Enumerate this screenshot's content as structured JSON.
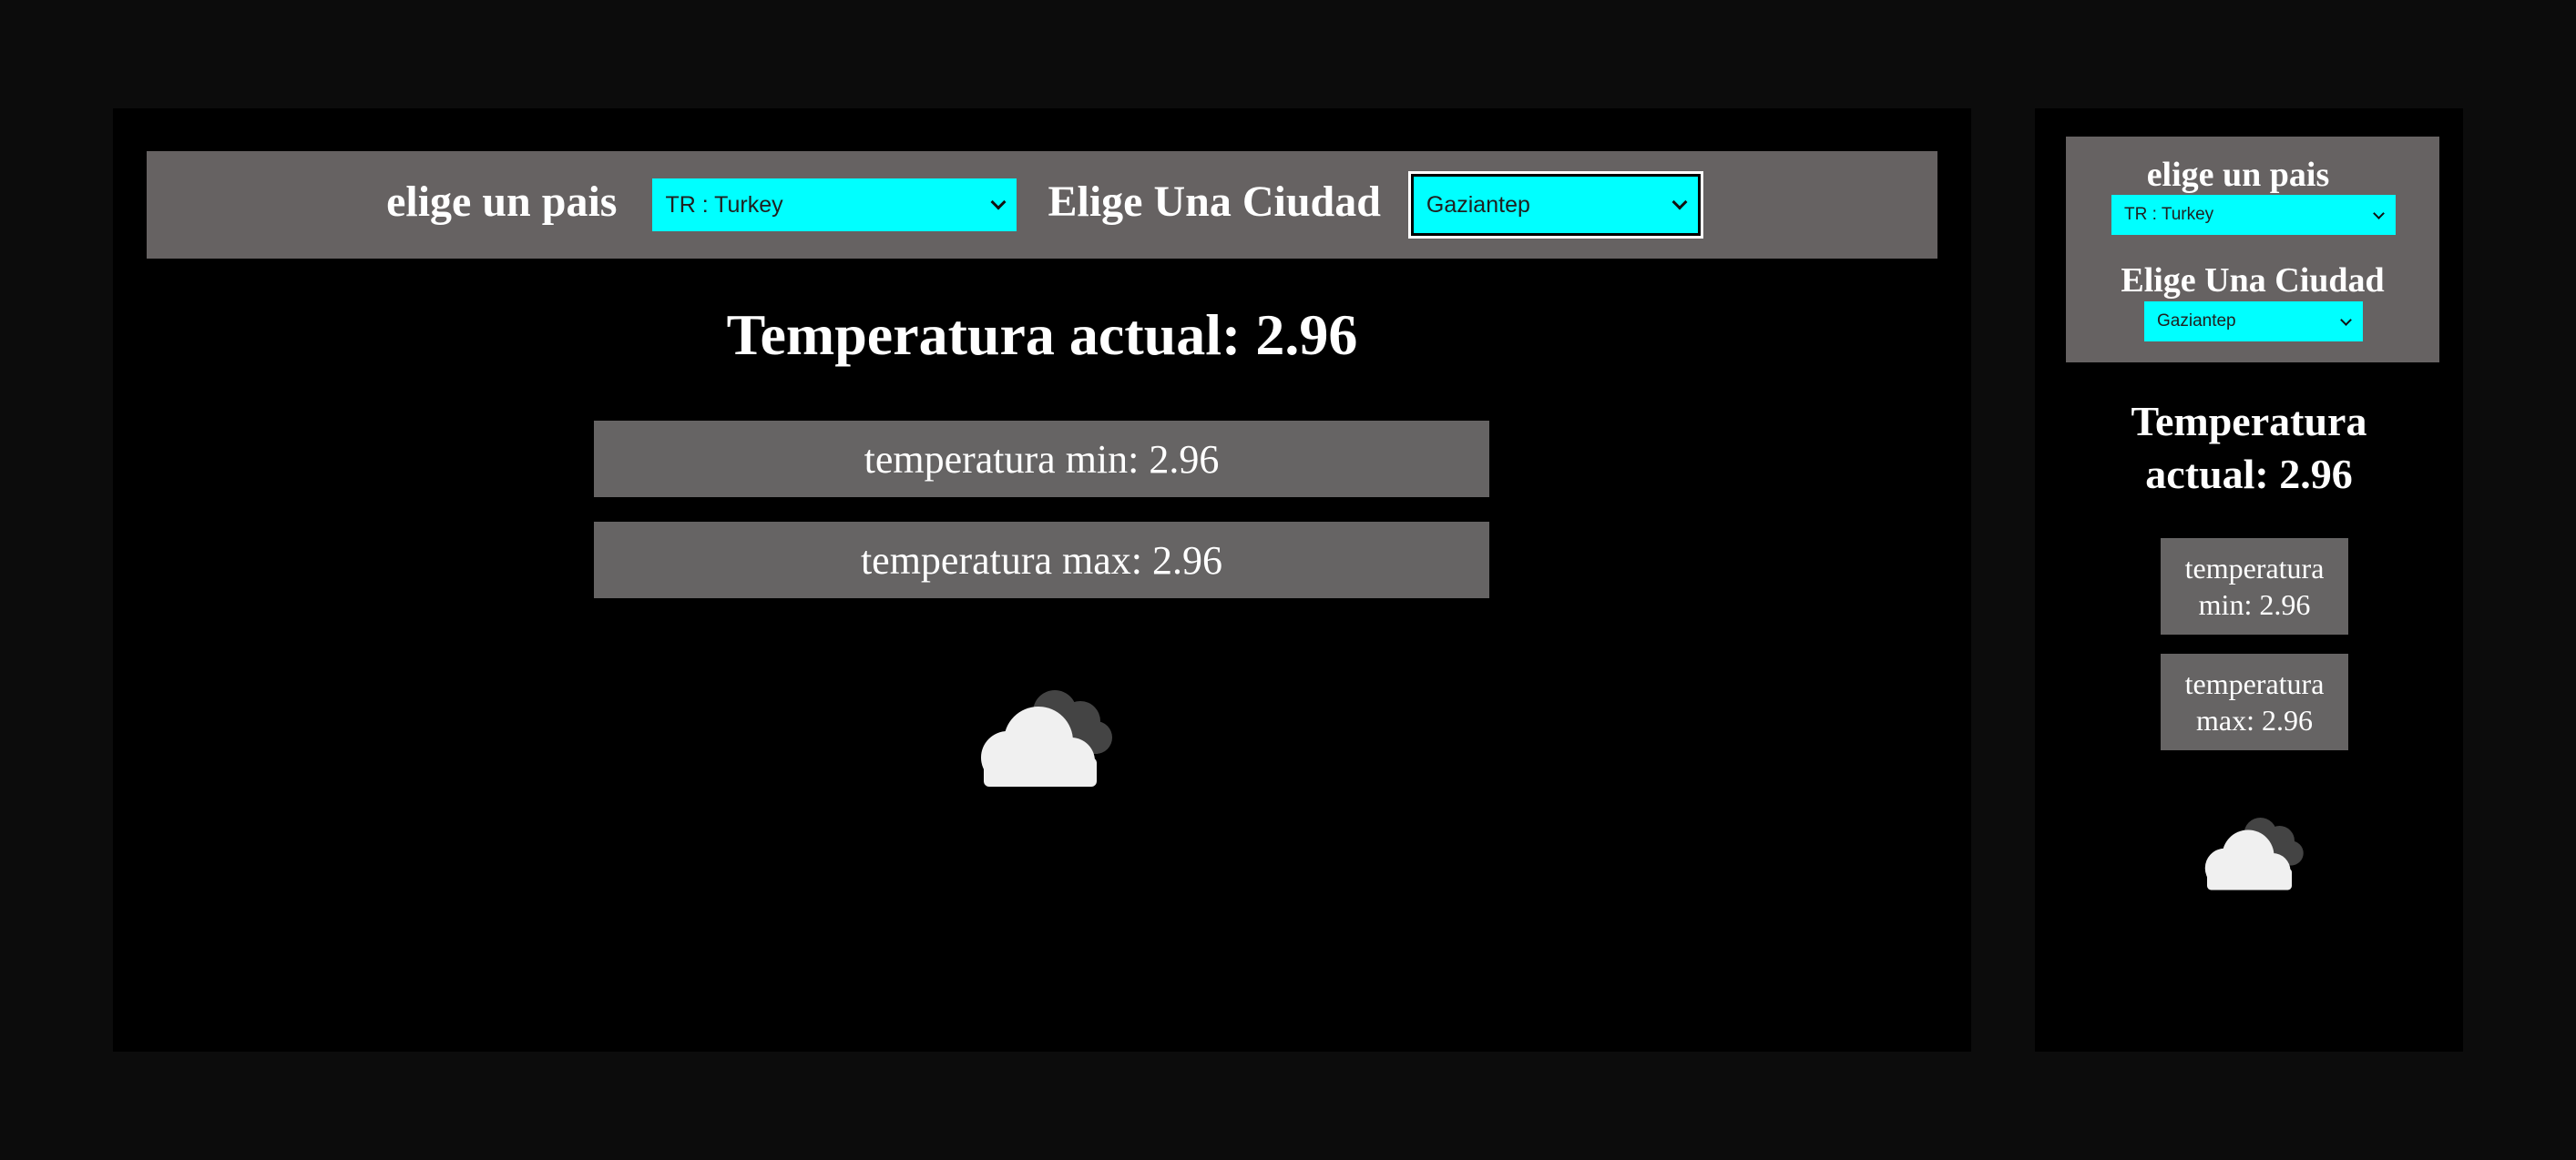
{
  "desktop": {
    "country_label": "elige un pais",
    "country_selected": "TR : Turkey",
    "city_label": "Elige Una Ciudad",
    "city_selected": "Gaziantep",
    "temp_actual": "Temperatura actual: 2.96",
    "temp_min": "temperatura min: 2.96",
    "temp_max": "temperatura max: 2.96",
    "weather_icon": "cloudy-icon"
  },
  "mobile": {
    "country_label": "elige un pais",
    "country_selected": "TR : Turkey",
    "city_label": "Elige Una Ciudad",
    "city_selected": "Gaziantep",
    "temp_actual": "Temperatura actual: 2.96",
    "temp_min": "temperatura min: 2.96",
    "temp_max": "temperatura max: 2.96",
    "weather_icon": "cloudy-icon"
  },
  "colors": {
    "page_bg": "#0c0c0c",
    "panel_bg": "#000000",
    "header_bg": "#666262",
    "select_bg": "#00ffff",
    "box_bg": "#666464",
    "text": "#ffffff"
  }
}
